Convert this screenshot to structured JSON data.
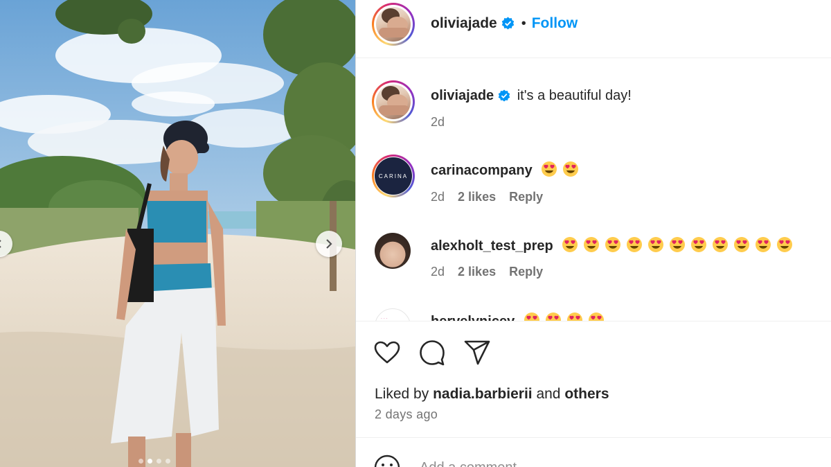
{
  "post": {
    "author": "oliviajade",
    "follow_label": "Follow",
    "separator": "•",
    "caption": "it's a beautiful day!",
    "caption_time": "2d"
  },
  "comments": [
    {
      "username": "carinacompany",
      "logo_text": "CARINA",
      "emoji_count": 2,
      "time": "2d",
      "likes": "2 likes",
      "reply": "Reply"
    },
    {
      "username": "alexholt_test_prep",
      "emoji_count": 11,
      "time": "2d",
      "likes": "2 likes",
      "reply": "Reply"
    },
    {
      "username": "hervelynicev",
      "emoji_count": 4
    }
  ],
  "liked_by": {
    "prefix": "Liked by",
    "user": "nadia.barbierii",
    "and": "and",
    "others": "others"
  },
  "posted": "2 days ago",
  "add_comment_placeholder": "Add a comment…",
  "carousel": {
    "count": 4,
    "active": 1
  },
  "icons": {
    "verified": "verified-badge-icon",
    "like": "heart-icon",
    "comment": "comment-bubble-icon",
    "share": "paper-plane-icon",
    "emoji": "smiling-face-with-heart-eyes",
    "next": "chevron-right-icon",
    "prev": "chevron-left-icon"
  },
  "colors": {
    "link": "#0095f6",
    "verified": "#0095f6",
    "muted": "#737373",
    "text": "#262626"
  }
}
